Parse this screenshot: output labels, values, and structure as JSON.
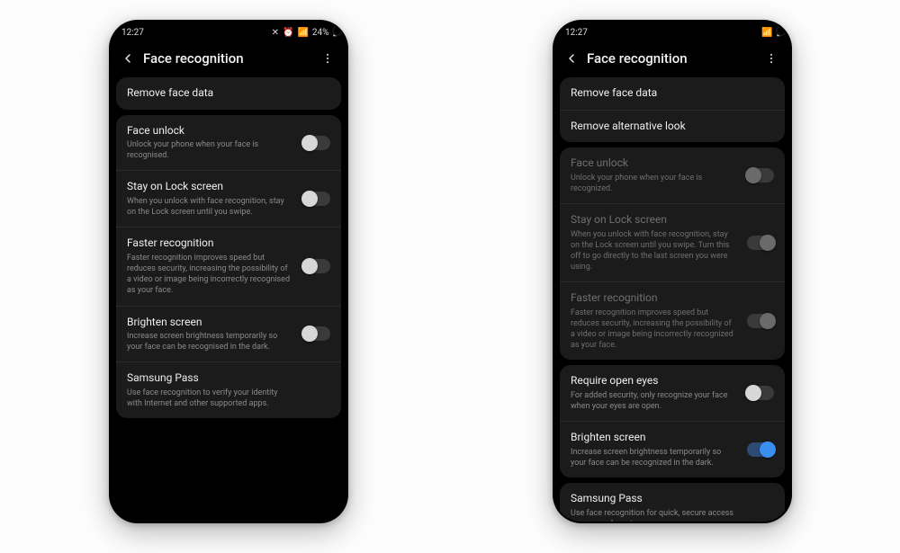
{
  "phones": [
    {
      "status": {
        "time": "12:27",
        "battery": "24%"
      },
      "header": {
        "title": "Face recognition"
      },
      "groups": [
        {
          "dimmed": false,
          "rows": [
            {
              "title": "Remove face data"
            }
          ]
        },
        {
          "dimmed": false,
          "rows": [
            {
              "title": "Face unlock",
              "sub": "Unlock your phone when your face is recognised.",
              "toggle": "off"
            },
            {
              "title": "Stay on Lock screen",
              "sub": "When you unlock with face recognition, stay on the Lock screen until you swipe.",
              "toggle": "off"
            },
            {
              "title": "Faster recognition",
              "sub": "Faster recognition improves speed but reduces security, increasing the possibility of a video or image being incorrectly recognised as your face.",
              "toggle": "off"
            },
            {
              "title": "Brighten screen",
              "sub": "Increase screen brightness temporarily so your face can be recognised in the dark.",
              "toggle": "off"
            },
            {
              "title": "Samsung Pass",
              "sub": "Use face recognition to verify your identity with Internet and other supported apps."
            }
          ]
        }
      ]
    },
    {
      "status": {
        "time": "12:27",
        "battery": ""
      },
      "header": {
        "title": "Face recognition"
      },
      "groups": [
        {
          "dimmed": false,
          "rows": [
            {
              "title": "Remove face data"
            },
            {
              "title": "Remove alternative look"
            }
          ]
        },
        {
          "dimmed": true,
          "rows": [
            {
              "title": "Face unlock",
              "sub": "Unlock your phone when your face is recognized.",
              "toggle": "dim-off"
            },
            {
              "title": "Stay on Lock screen",
              "sub": "When you unlock with face recognition, stay on the Lock screen until you swipe. Turn this off to go directly to the last screen you were using.",
              "toggle": "dim-on"
            },
            {
              "title": "Faster recognition",
              "sub": "Faster recognition improves speed but reduces security, increasing the possibility of a video or image being incorrectly recognized as your face.",
              "toggle": "dim-on"
            }
          ]
        },
        {
          "dimmed": false,
          "rows": [
            {
              "title": "Require open eyes",
              "sub": "For added security, only recognize your face when your eyes are open.",
              "toggle": "off"
            },
            {
              "title": "Brighten screen",
              "sub": "Increase screen brightness temporarily so your face can be recognized in the dark.",
              "toggle": "on-blue"
            }
          ]
        },
        {
          "dimmed": false,
          "rows": [
            {
              "title": "Samsung Pass",
              "sub": "Use face recognition for quick, secure access to apps and services."
            }
          ]
        }
      ]
    }
  ]
}
